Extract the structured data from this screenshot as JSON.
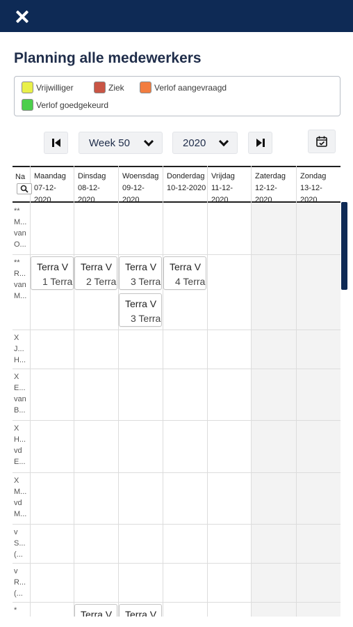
{
  "title": "Planning alle medewerkers",
  "legend": [
    {
      "label": "Vrijwilliger",
      "color": "#e9f04a"
    },
    {
      "label": "Ziek",
      "color": "#c95545"
    },
    {
      "label": "Verlof aangevraagd",
      "color": "#f27d40"
    },
    {
      "label": "Verlof goedgekeurd",
      "color": "#4ccf4c"
    }
  ],
  "controls": {
    "week_label": "Week 50",
    "year_label": "2020"
  },
  "columns": {
    "name_header": "Na",
    "days": [
      {
        "name": "Maandag",
        "date_line1": "07-12-",
        "date_line2": "2020"
      },
      {
        "name": "Dinsdag",
        "date_line1": "08-12-",
        "date_line2": "2020"
      },
      {
        "name": "Woensdag",
        "date_line1": "09-12-",
        "date_line2": "2020"
      },
      {
        "name": "Donderdag",
        "date_line1": "10-12-2020",
        "date_line2": ""
      },
      {
        "name": "Vrijdag",
        "date_line1": "11-12-",
        "date_line2": "2020"
      },
      {
        "name": "Zaterdag",
        "date_line1": "12-12-",
        "date_line2": "2020"
      },
      {
        "name": "Zondag",
        "date_line1": "13-12-",
        "date_line2": "2020"
      }
    ]
  },
  "rows": [
    {
      "name_lines": [
        "**",
        "M...",
        "van",
        "O..."
      ],
      "shifts": []
    },
    {
      "name_lines": [
        "**",
        "R...",
        "van",
        "M..."
      ],
      "shifts": [
        {
          "day": 0,
          "slot": 0,
          "line1": "Terra V",
          "line2": "1 Terra"
        },
        {
          "day": 1,
          "slot": 0,
          "line1": "Terra V",
          "line2": "2 Terra"
        },
        {
          "day": 2,
          "slot": 0,
          "line1": "Terra V",
          "line2": "3 Terra"
        },
        {
          "day": 3,
          "slot": 0,
          "line1": "Terra V",
          "line2": "4 Terra"
        },
        {
          "day": 2,
          "slot": 1,
          "line1": "Terra V",
          "line2": "3 Terra"
        }
      ]
    },
    {
      "name_lines": [
        "X",
        "J...",
        "H..."
      ],
      "shifts": []
    },
    {
      "name_lines": [
        "X",
        "E...",
        "van",
        "B..."
      ],
      "shifts": []
    },
    {
      "name_lines": [
        "X",
        "H...",
        "vd",
        "E..."
      ],
      "shifts": []
    },
    {
      "name_lines": [
        "X",
        "M...",
        "vd",
        "M..."
      ],
      "shifts": []
    },
    {
      "name_lines": [
        "v",
        "S...",
        "(..."
      ],
      "shifts": []
    },
    {
      "name_lines": [
        "v",
        "R...",
        "(..."
      ],
      "shifts": []
    },
    {
      "name_lines": [
        "*"
      ],
      "shifts": [
        {
          "day": 1,
          "slot": 0,
          "line1": "Terra V",
          "line2": ""
        },
        {
          "day": 2,
          "slot": 0,
          "line1": "Terra V",
          "line2": ""
        }
      ]
    }
  ]
}
